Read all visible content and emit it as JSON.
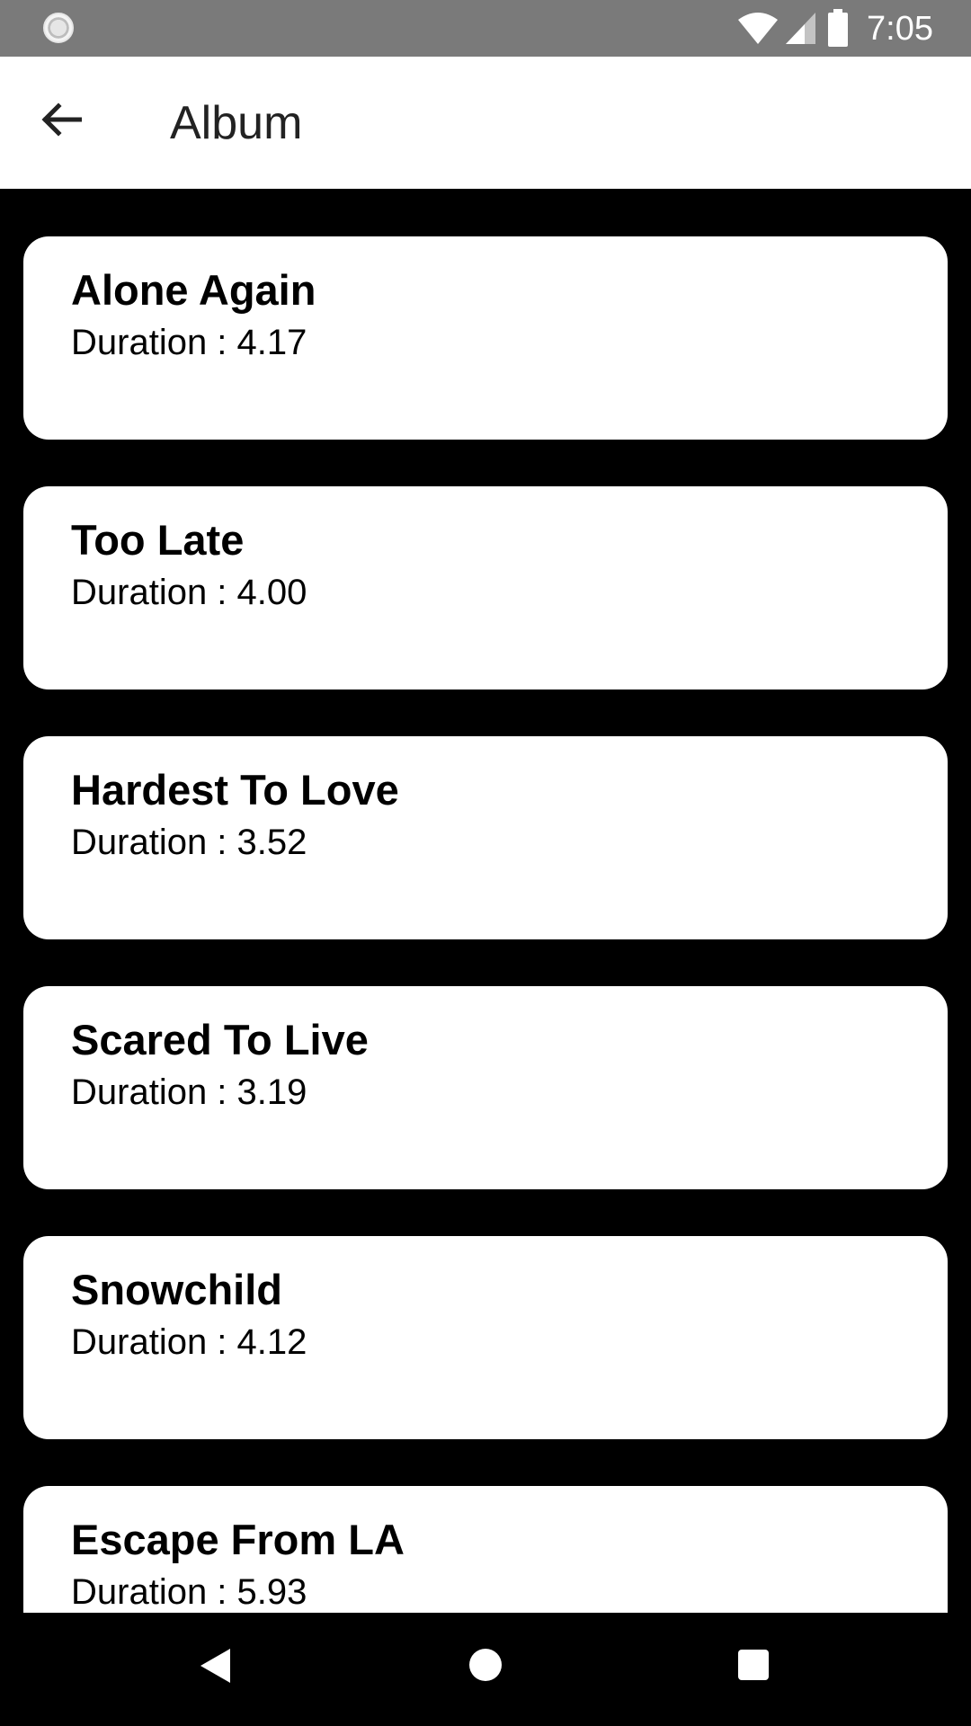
{
  "status_bar": {
    "time": "7:05",
    "icons": [
      "loading-icon",
      "wifi-icon",
      "signal-icon",
      "battery-icon"
    ]
  },
  "app_bar": {
    "title": "Album",
    "back_icon": "arrow-back-icon"
  },
  "tracks": [
    {
      "title": "Alone Again",
      "duration": "Duration : 4.17"
    },
    {
      "title": "Too Late",
      "duration": "Duration : 4.00"
    },
    {
      "title": "Hardest To Love",
      "duration": "Duration : 3.52"
    },
    {
      "title": "Scared To Live",
      "duration": "Duration : 3.19"
    },
    {
      "title": "Snowchild",
      "duration": "Duration : 4.12"
    },
    {
      "title": "Escape From LA",
      "duration": "Duration : 5.93"
    }
  ],
  "nav_bar": {
    "icons": [
      "nav-back-icon",
      "nav-home-icon",
      "nav-recents-icon"
    ]
  },
  "colors": {
    "status_bar_bg": "#7a7a7a",
    "app_bar_bg": "#ffffff",
    "page_bg": "#000000",
    "card_bg": "#ffffff",
    "text": "#000000"
  }
}
